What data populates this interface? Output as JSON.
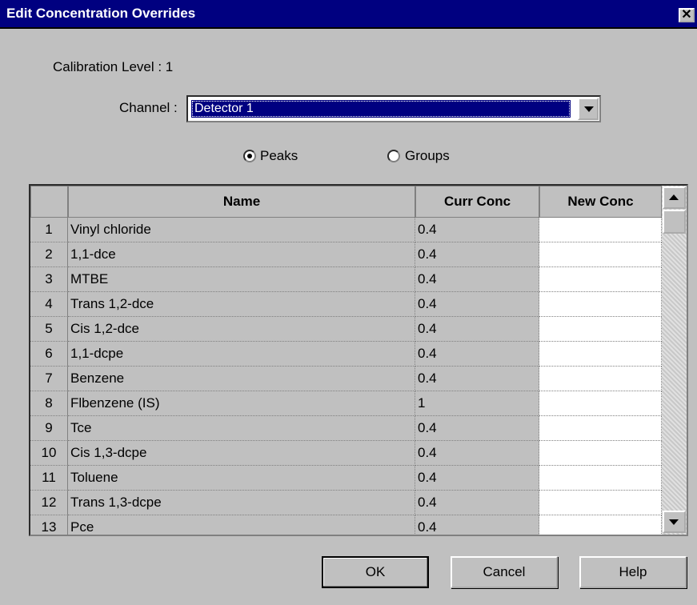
{
  "window": {
    "title": "Edit Concentration Overrides",
    "close_label": "✕"
  },
  "calibration": {
    "label": "Calibration Level : 1"
  },
  "channel": {
    "label": "Channel :",
    "value": "Detector 1"
  },
  "mode": {
    "peaks_label": "Peaks",
    "groups_label": "Groups",
    "selected": "Peaks"
  },
  "table": {
    "columns": {
      "num": "",
      "name": "Name",
      "curr": "Curr Conc",
      "new": "New Conc"
    },
    "rows": [
      {
        "num": "1",
        "name": "Vinyl chloride",
        "curr": "0.4",
        "new": ""
      },
      {
        "num": "2",
        "name": "1,1-dce",
        "curr": "0.4",
        "new": ""
      },
      {
        "num": "3",
        "name": "MTBE",
        "curr": "0.4",
        "new": ""
      },
      {
        "num": "4",
        "name": "Trans 1,2-dce",
        "curr": "0.4",
        "new": ""
      },
      {
        "num": "5",
        "name": "Cis 1,2-dce",
        "curr": "0.4",
        "new": ""
      },
      {
        "num": "6",
        "name": "1,1-dcpe",
        "curr": "0.4",
        "new": ""
      },
      {
        "num": "7",
        "name": "Benzene",
        "curr": "0.4",
        "new": ""
      },
      {
        "num": "8",
        "name": "Flbenzene (IS)",
        "curr": "1",
        "new": ""
      },
      {
        "num": "9",
        "name": "Tce",
        "curr": "0.4",
        "new": ""
      },
      {
        "num": "10",
        "name": "Cis 1,3-dcpe",
        "curr": "0.4",
        "new": ""
      },
      {
        "num": "11",
        "name": "Toluene",
        "curr": "0.4",
        "new": ""
      },
      {
        "num": "12",
        "name": "Trans 1,3-dcpe",
        "curr": "0.4",
        "new": ""
      },
      {
        "num": "13",
        "name": "Pce",
        "curr": "0.4",
        "new": ""
      }
    ]
  },
  "buttons": {
    "ok": "OK",
    "cancel": "Cancel",
    "help": "Help"
  }
}
